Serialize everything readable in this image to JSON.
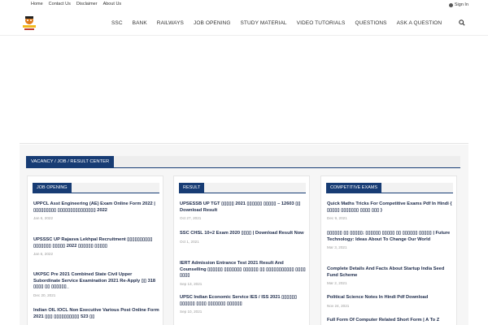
{
  "topbar": {
    "links": [
      "Home",
      "Contact Us",
      "Disclaimer",
      "About Us"
    ],
    "signin": "Sign In"
  },
  "nav": {
    "items": [
      "SSC",
      "BANK",
      "RAILWAYS",
      "JOB OPENING",
      "STUDY MATERIAL",
      "VIDEO TUTORIALS",
      "QUESTIONS",
      "ASK A QUESTION"
    ]
  },
  "section": {
    "title": "VACANCY / JOB / RESULT CENTER"
  },
  "columns": [
    {
      "title": "JOB OPENING",
      "posts": [
        {
          "title": "UPPCL Asst Engineering (AE) Exam Online Form 2022 |▯▯▯▯▯▯▯▯▯ ▯▯▯▯▯▯▯▯▯▯▯▯▯▯▯ 2022",
          "date": "Jan 6, 2022"
        },
        {
          "title": "UPSSSC UP Rajasva Lekhpal Recruitment ▯▯▯▯▯▯▯▯▯▯ ▯▯▯▯▯▯▯ ▯▯▯▯▯ 2022 ▯▯▯▯▯▯ ▯▯▯▯▯",
          "date": "Jan 6, 2022"
        },
        {
          "title": "UKPSC Pre 2021 Combined State Civil Upper Subordinate Service Examination 2021 Re-Apply ▯▯ 318 ▯▯▯▯ ▯▯ ▯▯▯▯▯▯_",
          "date": "Dec 20, 2021"
        },
        {
          "title": "Indian OIL IOCL Non Executive Various Post Online Form 2021 ▯▯▯ ▯▯▯▯▯▯▯▯▯▯ 523 ▯▯",
          "date": ""
        }
      ]
    },
    {
      "title": "RESULT",
      "posts": [
        {
          "title": "UPSESSB UP TGT ▯▯▯▯▯ 2021 ▯▯▯▯▯▯ ▯▯▯▯▯ – 12603 ▯▯ Download Result",
          "date": "Oct 27, 2021"
        },
        {
          "title": "SSC CHSL 10+2 Exam 2020 ▯▯▯▯ | Download Result Now",
          "date": "Oct 1, 2021"
        },
        {
          "title": "IERT Admission Entrance Test 2021 Result And Counselling ▯▯▯▯▯▯ ▯▯▯▯▯▯▯ ▯▯▯▯▯▯ ▯▯ ▯▯▯▯▯▯▯▯▯▯▯ ▯▯▯▯ ▯▯▯▯",
          "date": "Sep 13, 2021"
        },
        {
          "title": "UPSC Indian Economic Service IES / ISS 2021 ▯▯▯▯▯▯ ▯▯▯▯▯▯ ▯▯▯▯ ▯▯▯▯▯▯▯ ▯▯▯▯▯▯",
          "date": "Sep 10, 2021"
        }
      ]
    },
    {
      "title": "COMPETITIVE EXAMS",
      "posts": [
        {
          "title": "Quick Maths Tricks For Competitive Exams Pdf In Hindi { ▯▯▯▯▯ ▯▯▯▯▯▯▯ ▯▯▯▯ ▯▯▯ }",
          "date": "Dec 9, 2021"
        },
        {
          "title": "▯▯▯▯▯▯ ▯▯ ▯▯▯▯▯; ▯▯▯▯▯▯ ▯▯▯▯▯ ▯▯ ▯▯▯▯▯▯ ▯▯▯▯▯ | Future Technology: Ideas About To Change Our World",
          "date": "Mar 3, 2021"
        },
        {
          "title": "Complete Details And Facts About Startup India Seed Fund Scheme",
          "date": "Mar 2, 2021"
        },
        {
          "title": "Political Science Notes In Hindi Pdf Download",
          "date": "Nov 24, 2021"
        },
        {
          "title": "Full Form Of Computer Related Short Form | A To Z",
          "date": ""
        }
      ]
    }
  ],
  "colors": {
    "accent": "#173c74"
  }
}
